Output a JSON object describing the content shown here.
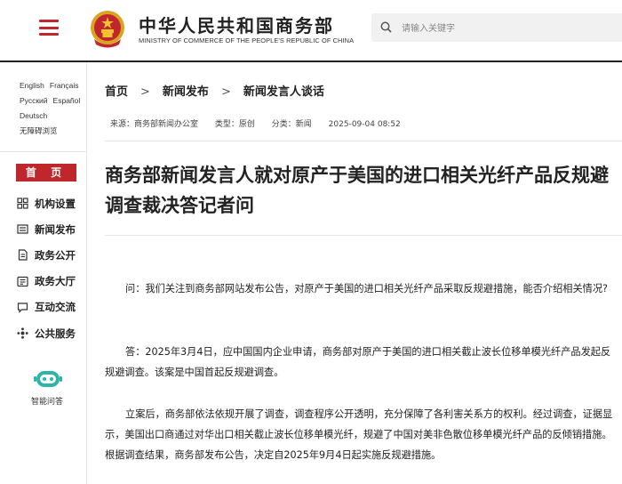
{
  "header": {
    "title": "中华人民共和国商务部",
    "subtitle": "MINISTRY OF COMMERCE OF THE PEOPLE'S REPUBLIC OF CHINA",
    "search_placeholder": "请输入关键字"
  },
  "colors": {
    "accent": "#c0272d"
  },
  "sidebar": {
    "languages": [
      [
        "English",
        "Français"
      ],
      [
        "Русский",
        "Español"
      ],
      [
        "Deutsch"
      ],
      [
        "无障碍浏览"
      ]
    ],
    "home_label": "首 页",
    "items": [
      {
        "label": "机构设置",
        "icon": "org-chart-icon"
      },
      {
        "label": "新闻发布",
        "icon": "newspaper-icon"
      },
      {
        "label": "政务公开",
        "icon": "document-icon"
      },
      {
        "label": "政务大厅",
        "icon": "service-hall-icon"
      },
      {
        "label": "互动交流",
        "icon": "chat-icon"
      },
      {
        "label": "公共服务",
        "icon": "public-service-icon"
      }
    ],
    "assistant_label": "智能问答"
  },
  "breadcrumb": [
    "首页",
    "新闻发布",
    "新闻发言人谈话"
  ],
  "meta": {
    "source": "来源：商务部新闻办公室",
    "type": "类型：原创",
    "category": "分类：新闻",
    "date": "2025-09-04 08:52"
  },
  "article": {
    "title": "商务部新闻发言人就对原产于美国的进口相关光纤产品反规避调查裁决答记者问",
    "paragraphs": [
      "问：我们关注到商务部网站发布公告，对原产于美国的进口相关光纤产品采取反规避措施，能否介绍相关情况?",
      "答：2025年3月4日，应中国国内企业申请，商务部对原产于美国的进口相关截止波长位移单模光纤产品发起反规避调查。该案是中国首起反规避调查。",
      "立案后，商务部依法依规开展了调查，调查程序公开透明，充分保障了各利害关系方的权利。经过调查，证据显示，美国出口商通过对华出口相关截止波长位移单模光纤，规避了中国对美非色散位移单模光纤产品的反倾销措施。根据调查结果，商务部发布公告，决定自2025年9月4日起实施反规避措施。"
    ]
  }
}
